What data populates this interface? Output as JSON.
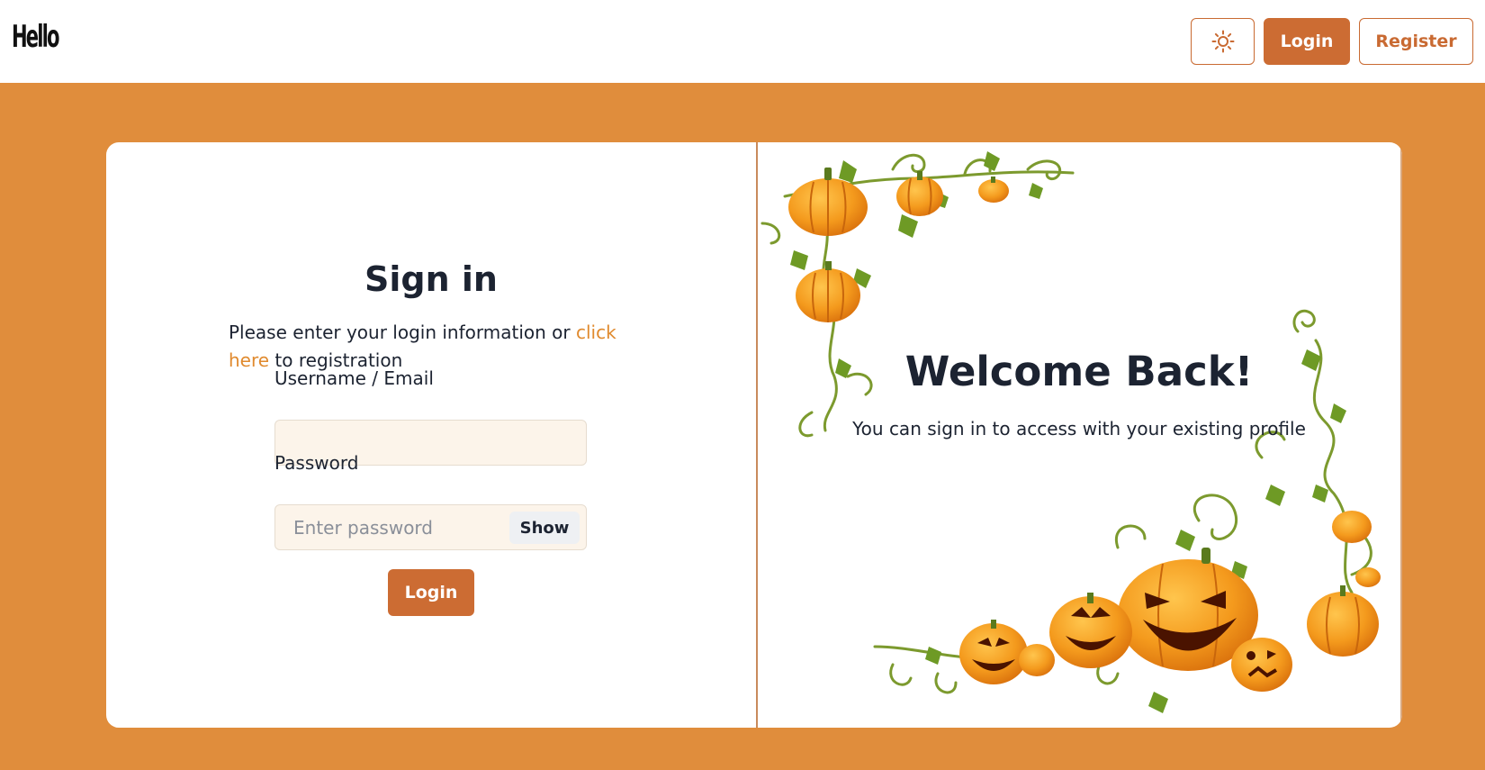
{
  "header": {
    "logo": "Hello",
    "theme_icon": "sun-icon",
    "login_label": "Login",
    "register_label": "Register"
  },
  "signin": {
    "title": "Sign in",
    "intro_text": "Please enter your login information or ",
    "intro_link": "click here",
    "intro_suffix": " to registration",
    "username_label": "Username / Email",
    "username_value": "",
    "password_label": "Password",
    "password_placeholder": "Enter password",
    "show_label": "Show",
    "submit_label": "Login"
  },
  "welcome": {
    "title": "Welcome Back!",
    "subtitle": "You can sign in to access with your existing profile"
  },
  "colors": {
    "accent": "#cc6c33",
    "background": "#e08d3c",
    "link": "#e08a2e",
    "input_bg": "#fcf4ea"
  }
}
